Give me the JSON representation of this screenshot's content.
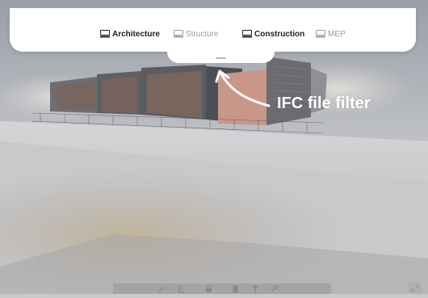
{
  "filters": {
    "architecture": {
      "label": "Architecture",
      "icon": "layer-icon",
      "state": "active"
    },
    "structure": {
      "label": "Structure",
      "icon": "layer-icon",
      "state": "inactive"
    },
    "construction": {
      "label": "Construction",
      "icon": "layer-icon",
      "state": "active"
    },
    "mep": {
      "label": "MEP",
      "icon": "layer-icon",
      "state": "inactive"
    }
  },
  "callout": {
    "text": "IFC file filter"
  },
  "colors": {
    "panel": "#ffffff",
    "active_text": "#1e1e1e",
    "inactive_text": "#9a9a9a",
    "callout": "#ffffff"
  },
  "toolbar": {
    "icons": [
      "pencil-icon",
      "measure-icon",
      "lock-icon",
      "clipboard-icon",
      "hammer-icon",
      "wrench-icon"
    ]
  }
}
